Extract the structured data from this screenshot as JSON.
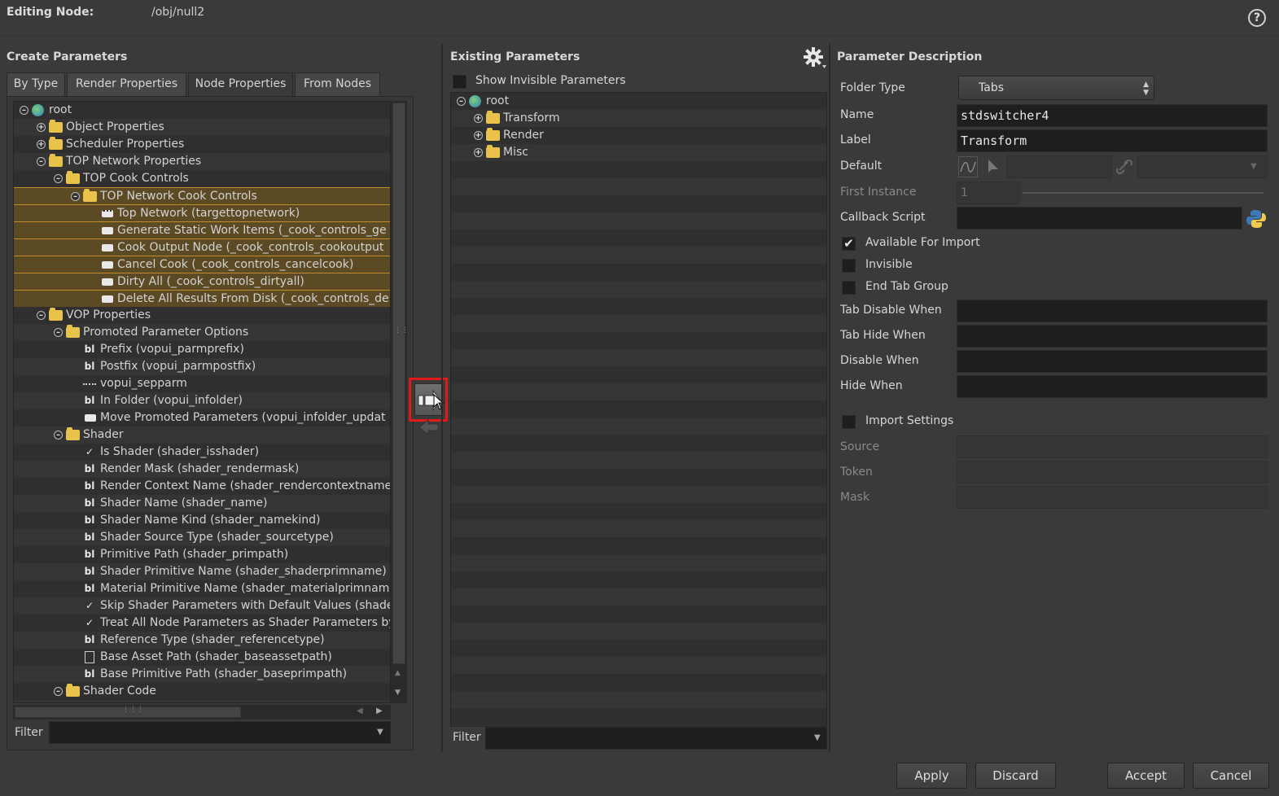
{
  "header": {
    "label": "Editing Node:",
    "path": "/obj/null2",
    "help": "?"
  },
  "create": {
    "title": "Create Parameters",
    "tabs": [
      "By Type",
      "Render Properties",
      "Node Properties",
      "From Nodes"
    ],
    "tree": [
      {
        "label": "root",
        "kind": "root",
        "indent": 0,
        "exp": "-"
      },
      {
        "label": "Object Properties",
        "kind": "folder",
        "indent": 1,
        "exp": "+"
      },
      {
        "label": "Scheduler Properties",
        "kind": "folder",
        "indent": 1,
        "exp": "+"
      },
      {
        "label": "TOP Network Properties",
        "kind": "folder",
        "indent": 1,
        "exp": "-"
      },
      {
        "label": "TOP Cook Controls",
        "kind": "folder",
        "indent": 2,
        "exp": "-"
      },
      {
        "label": "TOP Network Cook Controls",
        "kind": "folder",
        "indent": 3,
        "exp": "-",
        "hl": true
      },
      {
        "label": "Top Network (targettopnetwork)",
        "kind": "node",
        "indent": 4,
        "hl": true
      },
      {
        "label": "Generate Static Work Items (_cook_controls_ge",
        "kind": "button",
        "indent": 4,
        "hl": true
      },
      {
        "label": "Cook Output Node (_cook_controls_cookoutput",
        "kind": "button",
        "indent": 4,
        "hl": true
      },
      {
        "label": "Cancel Cook (_cook_controls_cancelcook)",
        "kind": "button",
        "indent": 4,
        "hl": true
      },
      {
        "label": "Dirty All (_cook_controls_dirtyall)",
        "kind": "button",
        "indent": 4,
        "hl": true
      },
      {
        "label": "Delete All Results From Disk (_cook_controls_de",
        "kind": "button",
        "indent": 4,
        "hl": true
      },
      {
        "label": "VOP Properties",
        "kind": "folder",
        "indent": 1,
        "exp": "-"
      },
      {
        "label": "Promoted Parameter Options",
        "kind": "folder",
        "indent": 2,
        "exp": "-"
      },
      {
        "label": "Prefix (vopui_parmprefix)",
        "kind": "string",
        "indent": 3
      },
      {
        "label": "Postfix (vopui_parmpostfix)",
        "kind": "string",
        "indent": 3
      },
      {
        "label": "vopui_sepparm",
        "kind": "sep",
        "indent": 3
      },
      {
        "label": "In Folder (vopui_infolder)",
        "kind": "string",
        "indent": 3
      },
      {
        "label": "Move Promoted Parameters (vopui_infolder_updat",
        "kind": "button",
        "indent": 3
      },
      {
        "label": "Shader",
        "kind": "folder",
        "indent": 2,
        "exp": "-"
      },
      {
        "label": "Is Shader (shader_isshader)",
        "kind": "toggle",
        "indent": 3
      },
      {
        "label": "Render Mask (shader_rendermask)",
        "kind": "string",
        "indent": 3
      },
      {
        "label": "Render Context Name (shader_rendercontextname",
        "kind": "string",
        "indent": 3
      },
      {
        "label": "Shader Name (shader_name)",
        "kind": "string",
        "indent": 3
      },
      {
        "label": "Shader Name Kind (shader_namekind)",
        "kind": "string",
        "indent": 3
      },
      {
        "label": "Shader Source Type (shader_sourcetype)",
        "kind": "string",
        "indent": 3
      },
      {
        "label": "Primitive Path (shader_primpath)",
        "kind": "string",
        "indent": 3
      },
      {
        "label": "Shader Primitive Name (shader_shaderprimname)",
        "kind": "string",
        "indent": 3
      },
      {
        "label": "Material Primitive Name (shader_materialprimnam",
        "kind": "string",
        "indent": 3
      },
      {
        "label": "Skip Shader Parameters with Default Values (shade",
        "kind": "toggle",
        "indent": 3
      },
      {
        "label": "Treat All Node Parameters as Shader Parameters by",
        "kind": "toggle",
        "indent": 3
      },
      {
        "label": "Reference Type (shader_referencetype)",
        "kind": "string",
        "indent": 3
      },
      {
        "label": "Base Asset Path (shader_baseassetpath)",
        "kind": "file",
        "indent": 3
      },
      {
        "label": "Base Primitive Path (shader_baseprimpath)",
        "kind": "string",
        "indent": 3
      },
      {
        "label": "Shader Code",
        "kind": "folder",
        "indent": 2,
        "exp": "-"
      }
    ],
    "filter_label": "Filter"
  },
  "existing": {
    "title": "Existing Parameters",
    "show_invisible": "Show Invisible Parameters",
    "tree": [
      {
        "label": "root",
        "kind": "root",
        "indent": 0,
        "exp": "-"
      },
      {
        "label": "Transform",
        "kind": "folder",
        "indent": 1,
        "exp": "+"
      },
      {
        "label": "Render",
        "kind": "folder",
        "indent": 1,
        "exp": "+"
      },
      {
        "label": "Misc",
        "kind": "folder",
        "indent": 1,
        "exp": "+"
      }
    ],
    "filter_label": "Filter"
  },
  "desc": {
    "title": "Parameter Description",
    "folder_type_label": "Folder Type",
    "folder_type_value": "Tabs",
    "name_label": "Name",
    "name_value": "stdswitcher4",
    "label_label": "Label",
    "label_value": "Transform",
    "default_label": "Default",
    "first_instance_label": "First Instance",
    "first_instance_value": "1",
    "callback_label": "Callback Script",
    "available_for_import": "Available For Import",
    "invisible": "Invisible",
    "end_tab_group": "End Tab Group",
    "tab_disable_when": "Tab Disable When",
    "tab_hide_when": "Tab Hide When",
    "disable_when": "Disable When",
    "hide_when": "Hide When",
    "import_settings": "Import Settings",
    "source": "Source",
    "token": "Token",
    "mask": "Mask",
    "checked_mark": "✔"
  },
  "buttons": {
    "apply": "Apply",
    "discard": "Discard",
    "accept": "Accept",
    "cancel": "Cancel"
  },
  "colors": {
    "highlight_border": "#c08c2a",
    "highlight_fill": "#5c4a25",
    "annotation_red": "#e01a1a",
    "folder": "#e8c24a"
  }
}
